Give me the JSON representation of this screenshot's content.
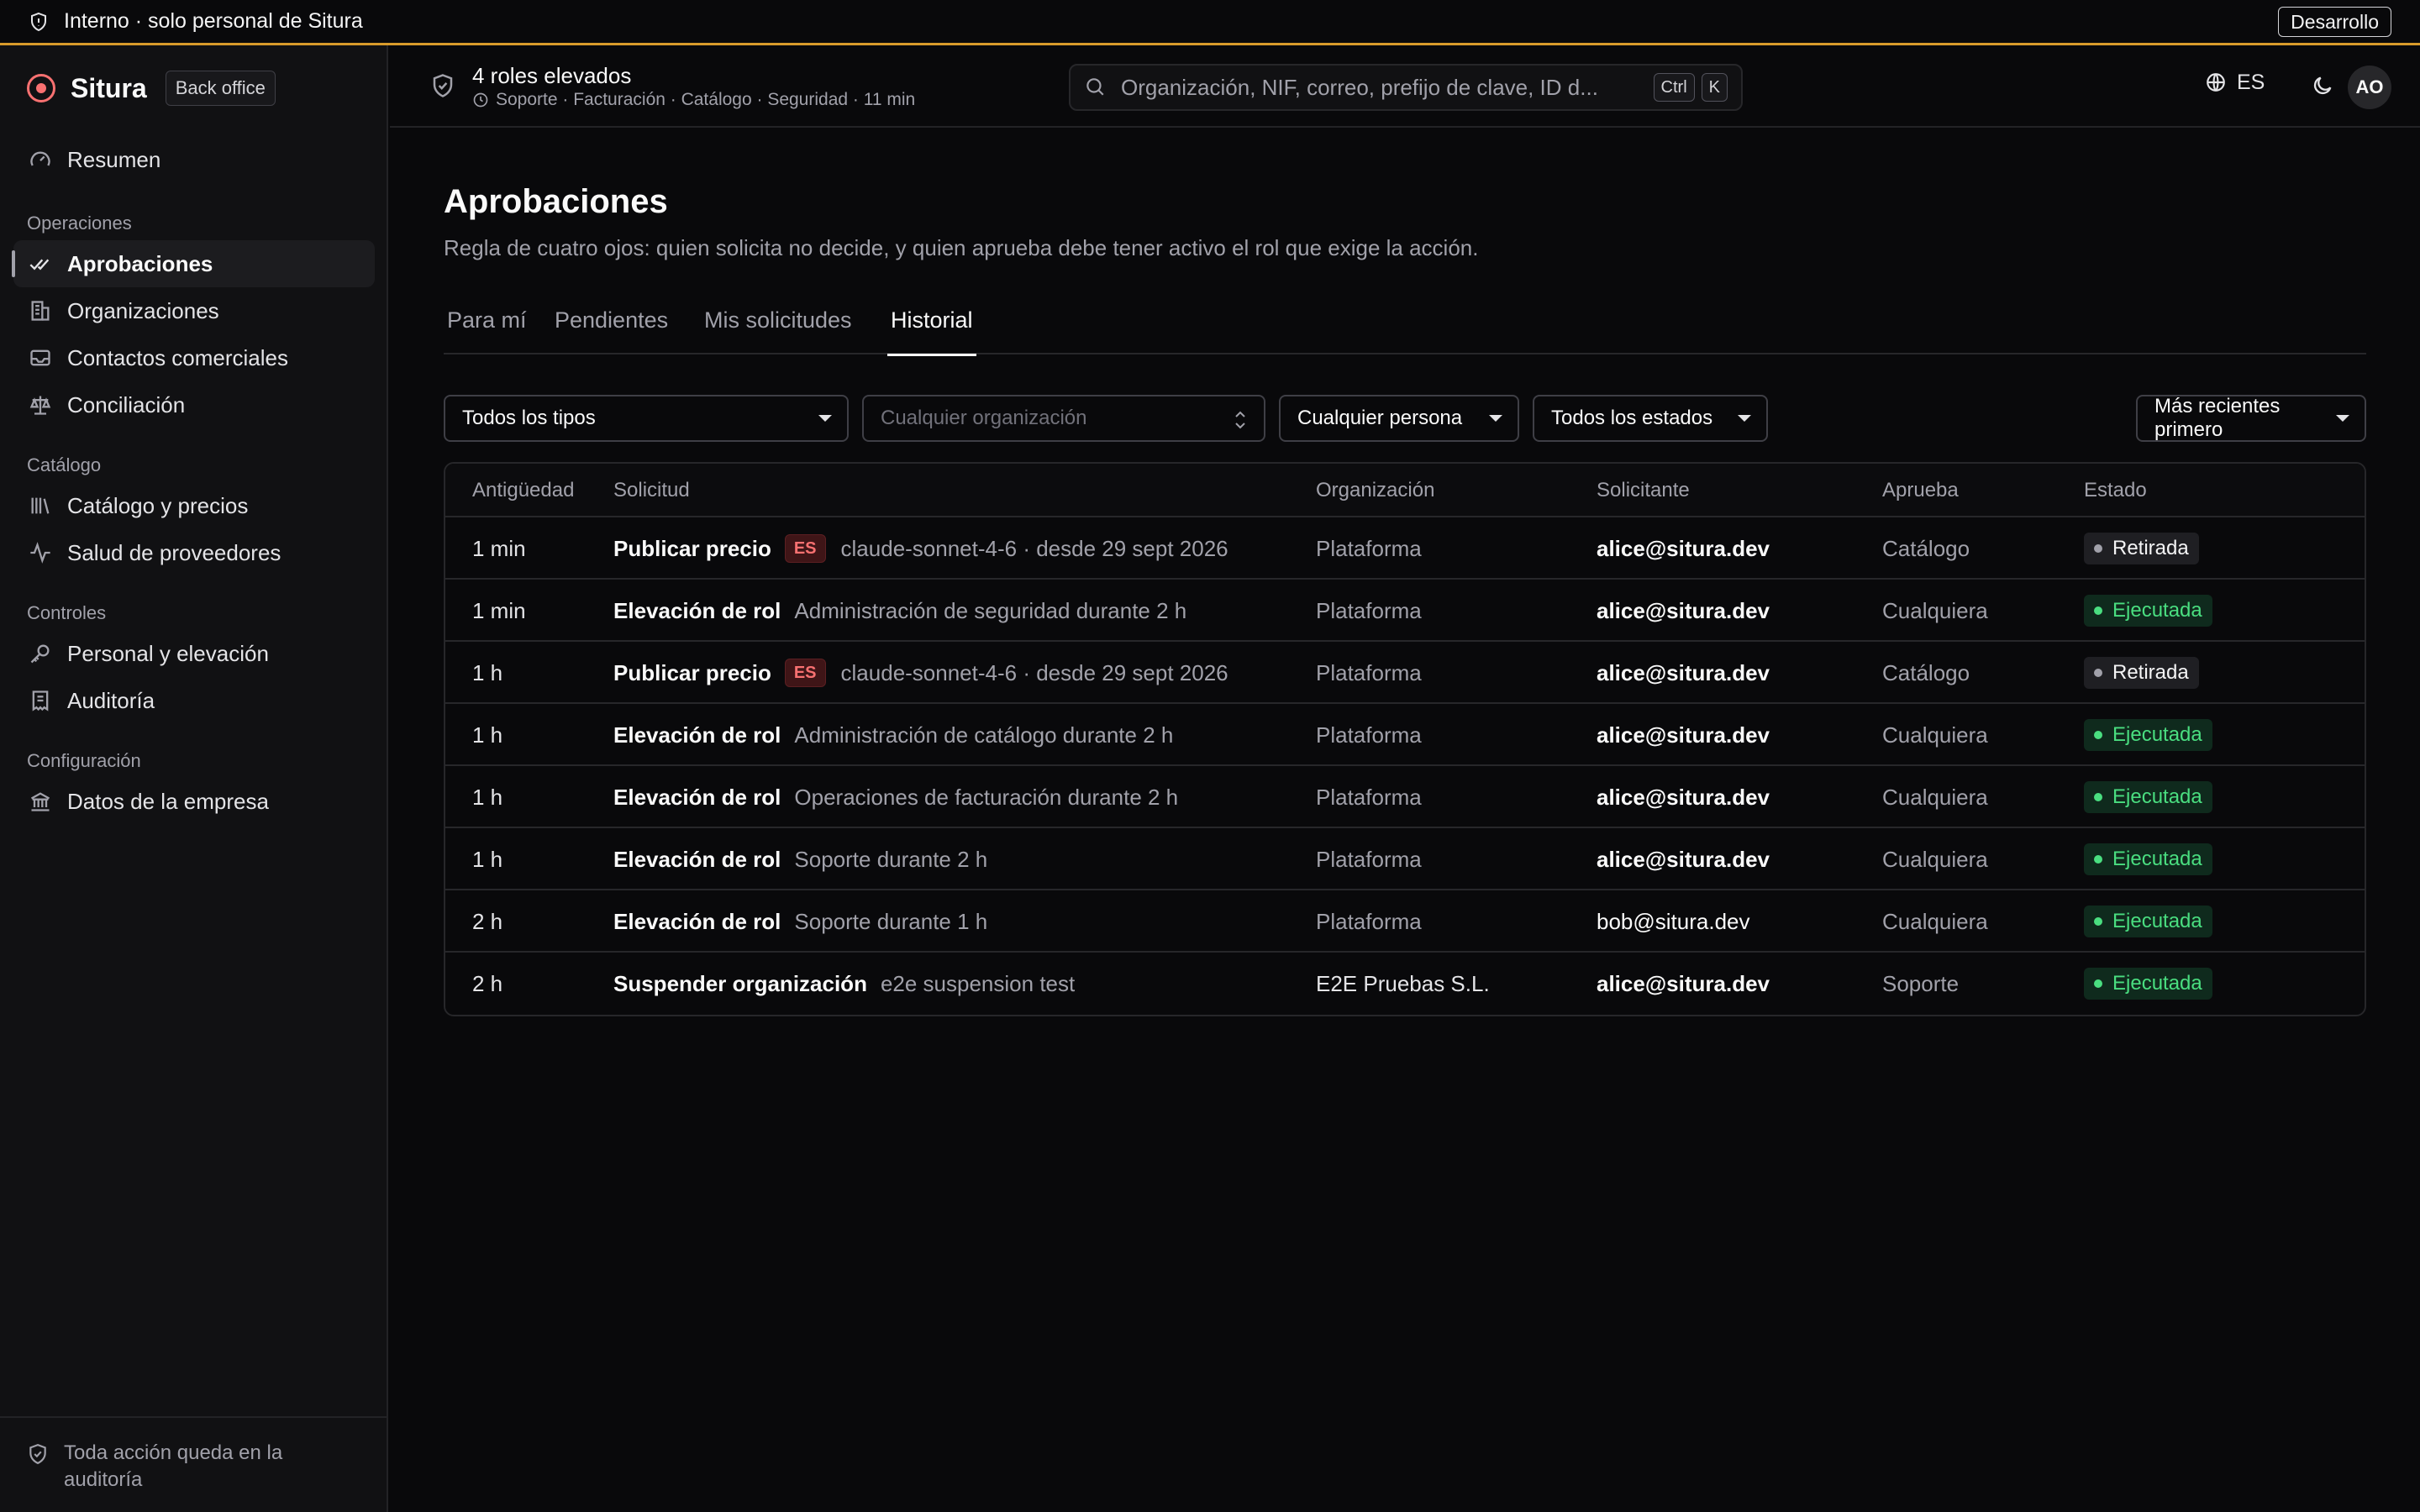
{
  "banner": {
    "text": "Interno · solo personal de Situra",
    "env": "Desarrollo"
  },
  "brand": {
    "name": "Situra",
    "tag": "Back office"
  },
  "nav": {
    "summary": "Resumen",
    "groups": [
      {
        "label": "Operaciones",
        "items": [
          "Aprobaciones",
          "Organizaciones",
          "Contactos comerciales",
          "Conciliación"
        ]
      },
      {
        "label": "Catálogo",
        "items": [
          "Catálogo y precios",
          "Salud de proveedores"
        ]
      },
      {
        "label": "Controles",
        "items": [
          "Personal y elevación",
          "Auditoría"
        ]
      },
      {
        "label": "Configuración",
        "items": [
          "Datos de la empresa"
        ]
      }
    ],
    "active": "Aprobaciones"
  },
  "sidebar_footer": "Toda acción queda en la auditoría",
  "header": {
    "roles_title": "4 roles elevados",
    "roles_sub": "Soporte · Facturación · Catálogo · Seguridad · 11 min",
    "search_placeholder": "Organización, NIF, correo, prefijo de clave, ID d...",
    "kbd_ctrl": "Ctrl",
    "kbd_k": "K",
    "lang": "ES",
    "avatar": "AO",
    "icons": [
      "shield-check-icon",
      "search-icon",
      "globe-icon",
      "moon-icon"
    ]
  },
  "page": {
    "title": "Aprobaciones",
    "description": "Regla de cuatro ojos: quien solicita no decide, y quien aprueba debe tener activo el rol que exige la acción.",
    "tabs": [
      "Para mí",
      "Pendientes",
      "Mis solicitudes",
      "Historial"
    ],
    "active_tab": "Historial"
  },
  "filters": {
    "type": "Todos los tipos",
    "org_placeholder": "Cualquier organización",
    "person": "Cualquier persona",
    "status": "Todos los estados",
    "sort": "Más recientes primero"
  },
  "table": {
    "columns": [
      "Antigüedad",
      "Solicitud",
      "Organización",
      "Solicitante",
      "Aprueba",
      "Estado"
    ],
    "rows": [
      {
        "age": "1 min",
        "type": "Publicar precio",
        "badge": "ES",
        "detail": "claude-sonnet-4-6 · desde 29 sept 2026",
        "org": "Plataforma",
        "user": "alice@situra.dev",
        "approver": "Catálogo",
        "status": "Retirada",
        "tone": "gray"
      },
      {
        "age": "1 min",
        "type": "Elevación de rol",
        "badge": "",
        "detail": "Administración de seguridad durante 2 h",
        "org": "Plataforma",
        "user": "alice@situra.dev",
        "approver": "Cualquiera",
        "status": "Ejecutada",
        "tone": "green"
      },
      {
        "age": "1 h",
        "type": "Publicar precio",
        "badge": "ES",
        "detail": "claude-sonnet-4-6 · desde 29 sept 2026",
        "org": "Plataforma",
        "user": "alice@situra.dev",
        "approver": "Catálogo",
        "status": "Retirada",
        "tone": "gray"
      },
      {
        "age": "1 h",
        "type": "Elevación de rol",
        "badge": "",
        "detail": "Administración de catálogo durante 2 h",
        "org": "Plataforma",
        "user": "alice@situra.dev",
        "approver": "Cualquiera",
        "status": "Ejecutada",
        "tone": "green"
      },
      {
        "age": "1 h",
        "type": "Elevación de rol",
        "badge": "",
        "detail": "Operaciones de facturación durante 2 h",
        "org": "Plataforma",
        "user": "alice@situra.dev",
        "approver": "Cualquiera",
        "status": "Ejecutada",
        "tone": "green"
      },
      {
        "age": "1 h",
        "type": "Elevación de rol",
        "badge": "",
        "detail": "Soporte durante 2 h",
        "org": "Plataforma",
        "user": "alice@situra.dev",
        "approver": "Cualquiera",
        "status": "Ejecutada",
        "tone": "green"
      },
      {
        "age": "2 h",
        "type": "Elevación de rol",
        "badge": "",
        "detail": "Soporte durante 1 h",
        "org": "Plataforma",
        "user": "bob@situra.dev",
        "approver": "Cualquiera",
        "status": "Ejecutada",
        "tone": "green"
      },
      {
        "age": "2 h",
        "type": "Suspender organización",
        "badge": "",
        "detail": "e2e suspension test",
        "org": "E2E Pruebas S.L.",
        "user": "alice@situra.dev",
        "approver": "Soporte",
        "status": "Ejecutada",
        "tone": "green"
      }
    ]
  },
  "colors": {
    "accent_banner": "#d89b2b",
    "brand": "#f87171",
    "success": "#4ade80",
    "background": "#09090b"
  }
}
